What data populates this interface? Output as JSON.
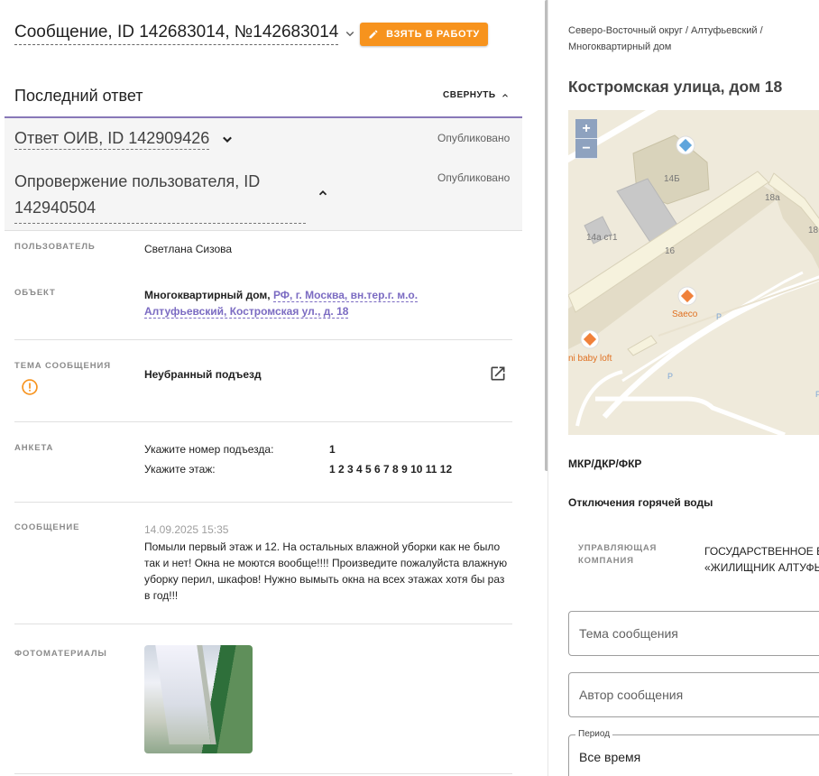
{
  "header": {
    "title": "Сообщение, ID 142683014, №142683014",
    "take_button": "ВЗЯТЬ В РАБОТУ"
  },
  "last_reply": {
    "title": "Последний ответ",
    "collapse_label": "СВЕРНУТЬ",
    "reply1_title": "Ответ ОИВ, ID 142909426",
    "reply1_status": "Опубликовано",
    "reply2_title": "Опровержение пользователя, ID 142940504",
    "reply2_status": "Опубликовано"
  },
  "details": {
    "user_label": "ПОЛЬЗОВАТЕЛЬ",
    "user_value": "Светлана Сизова",
    "object_label": "ОБЪЕКТ",
    "object_type": "Многоквартирный дом,",
    "object_address": "РФ, г. Москва, вн.тер.г. м.о. Алтуфьевский, Костромская ул., д. 18",
    "topic_label": "ТЕМА СООБЩЕНИЯ",
    "topic_value": "Неубранный подъезд",
    "survey_label": "АНКЕТА",
    "survey": [
      {
        "q": "Укажите номер подъезда:",
        "a": "1"
      },
      {
        "q": "Укажите этаж:",
        "a": "1 2 3 4 5 6 7 8 9 10 11 12"
      }
    ],
    "message_label": "СООБЩЕНИЕ",
    "message_date": "14.09.2025 15:35",
    "message_text": "Помыли первый этаж и 12. На остальных влажной уборки как не было так и нет! Окна не моются вообще!!!! Произведите пожалуйста влажную уборку перил, шкафов! Нужно вымыть окна на всех этажах хотя бы раз в год!!!",
    "photos_label": "ФОТОМАТЕРИАЛЫ"
  },
  "right": {
    "breadcrumb": "Северо-Восточный округ / Алтуфьевский / Многоквартирный дом",
    "address": "Костромская улица, дом 18",
    "map": {
      "zoom_in": "+",
      "zoom_out": "−",
      "labels": [
        "14Б",
        "18а",
        "18",
        "14а ст1",
        "16",
        "Saeco",
        "ni baby loft"
      ]
    },
    "mkr_label": "МКР/ДКР/ФКР",
    "hot_water_label": "Отключения горячей воды",
    "mgmt_label": "УПРАВЛЯЮЩАЯ КОМПАНИЯ",
    "mgmt_value_line1": "ГОСУДАРСТВЕННОЕ Б",
    "mgmt_value_line2": "«ЖИЛИЩНИК АЛТУФЬ",
    "topic_field_placeholder": "Тема сообщения",
    "author_field_placeholder": "Автор сообщения",
    "period_label": "Период",
    "period_value": "Все время"
  },
  "colors": {
    "accent_orange": "#f7931d",
    "accent_purple": "#8878b8",
    "link": "#7b6bc2",
    "warning": "#f7931d"
  }
}
